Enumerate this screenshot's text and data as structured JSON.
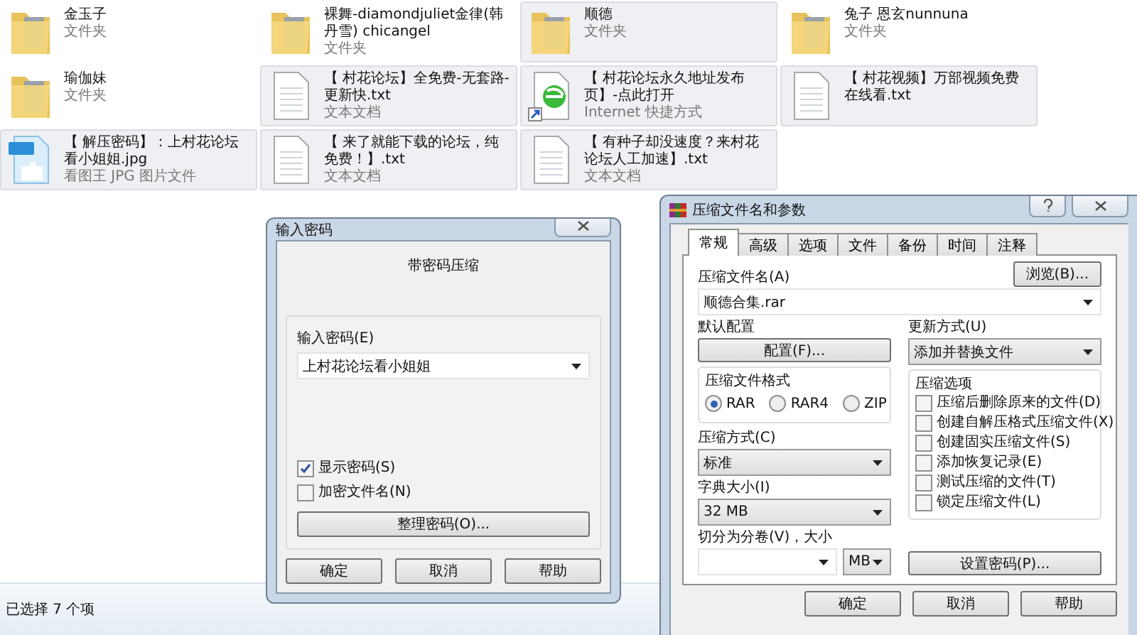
{
  "explorer": {
    "items": [
      {
        "kind": "folder",
        "name": "金玉子",
        "type": "文件夹",
        "selected": false
      },
      {
        "kind": "folder",
        "name": "裸舞-diamondjuliet金律(韩丹雪) chicangel",
        "type": "文件夹",
        "selected": false
      },
      {
        "kind": "folder",
        "name": "顺德",
        "type": "文件夹",
        "selected": true
      },
      {
        "kind": "folder",
        "name": "兔子 恩玄nunnuna",
        "type": "文件夹",
        "selected": false
      },
      {
        "kind": "folder",
        "name": "瑜伽妹",
        "type": "文件夹",
        "selected": false
      },
      {
        "kind": "text",
        "name": "【 村花论坛】全免费-无套路-更新快.txt",
        "type": "文本文档",
        "selected": true
      },
      {
        "kind": "shortcut",
        "name": "【 村花论坛永久地址发布页】-点此打开",
        "type": "Internet 快捷方式",
        "selected": true
      },
      {
        "kind": "text",
        "name": "【 村花视频】万部视频免费在线看.txt",
        "selected": true
      },
      {
        "kind": "image",
        "name": "【 解压密码】：上村花论坛看小姐姐.jpg",
        "type": "看图王 JPG 图片文件",
        "selected": true
      },
      {
        "kind": "text",
        "name": "【 来了就能下载的论坛，纯免费！】.txt",
        "type": "文本文档",
        "selected": true
      },
      {
        "kind": "text",
        "name": "【 有种子却没速度？来村花论坛人工加速】.txt",
        "type": "文本文档",
        "selected": true
      }
    ],
    "status_text": "已选择 7 个项"
  },
  "password_dialog": {
    "title": "输入密码",
    "heading": "带密码压缩",
    "password_label": "输入密码(E)",
    "password_value": "上村花论坛看小姐姐",
    "options": [
      {
        "label": "显示密码(S)",
        "checked": true
      },
      {
        "label": "加密文件名(N)",
        "checked": false
      }
    ],
    "manage_button": "整理密码(O)...",
    "buttons": [
      "确定",
      "取消",
      "帮助"
    ]
  },
  "archive_dialog": {
    "title": "压缩文件名和参数",
    "tabs": [
      {
        "label": "常规",
        "selected": true
      },
      {
        "label": "高级",
        "selected": false
      },
      {
        "label": "选项",
        "selected": false
      },
      {
        "label": "文件",
        "selected": false
      },
      {
        "label": "备份",
        "selected": false
      },
      {
        "label": "时间",
        "selected": false
      },
      {
        "label": "注释",
        "selected": false
      }
    ],
    "archive_name_label": "压缩文件名(A)",
    "archive_name_value": "顺德合集.rar",
    "browse_button": "浏览(B)...",
    "profile_label": "默认配置",
    "profile_button": "配置(F)...",
    "update_label": "更新方式(U)",
    "update_value": "添加并替换文件",
    "format_label": "压缩文件格式",
    "formats": [
      {
        "label": "RAR",
        "selected": true
      },
      {
        "label": "RAR4",
        "selected": false
      },
      {
        "label": "ZIP",
        "selected": false
      }
    ],
    "method_label": "压缩方式(C)",
    "method_value": "标准",
    "dict_label": "字典大小(I)",
    "dict_value": "32 MB",
    "split_label": "切分为分卷(V)，大小",
    "split_unit": "MB",
    "options_label": "压缩选项",
    "options": [
      {
        "label": "压缩后删除原来的文件(D)",
        "checked": false
      },
      {
        "label": "创建自解压格式压缩文件(X)",
        "checked": false
      },
      {
        "label": "创建固实压缩文件(S)",
        "checked": false
      },
      {
        "label": "添加恢复记录(E)",
        "checked": false
      },
      {
        "label": "测试压缩的文件(T)",
        "checked": false
      },
      {
        "label": "锁定压缩文件(L)",
        "checked": false
      }
    ],
    "password_button": "设置密码(P)...",
    "buttons": [
      "确定",
      "取消",
      "帮助"
    ]
  }
}
